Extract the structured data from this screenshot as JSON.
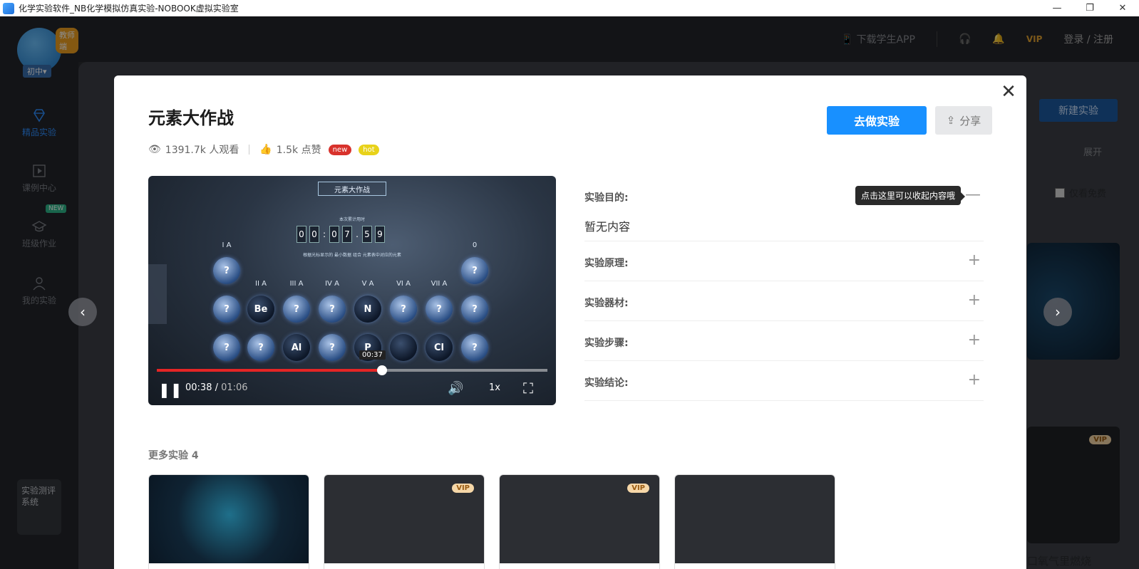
{
  "window": {
    "title": "化学实验软件_NB化学模拟仿真实验-NOBOOK虚拟实验室",
    "minimize": "—",
    "maximize": "❐",
    "close": "✕"
  },
  "sidebar": {
    "badge": "教师端",
    "level": "初中▾",
    "items": [
      {
        "label": "精品实验",
        "icon": "diamond-icon"
      },
      {
        "label": "课例中心",
        "icon": "play-square-icon"
      },
      {
        "label": "班级作业",
        "icon": "graduation-cap-icon"
      },
      {
        "label": "我的实验",
        "icon": "user-icon"
      }
    ],
    "new_tag": "NEW",
    "eval_label": "实验测评系统"
  },
  "topbar": {
    "download": "下载学生APP",
    "vip": "VIP",
    "login": "登录 / 注册"
  },
  "background": {
    "new_experiment": "新建实验",
    "expand": "展开",
    "free_only": "仅看免费",
    "caption": "口氧气里燃烧",
    "vip": "VIP"
  },
  "modal": {
    "title": "元素大作战",
    "views": "1391.7k 人观看",
    "likes": "1.5k 点赞",
    "badge_new": "new",
    "badge_hot": "hot",
    "primary_button": "去做实验",
    "share_button": "分享",
    "close": "✕",
    "video": {
      "inner_title": "元素大作战",
      "subtitle": "本次累计用时",
      "timer": [
        "0",
        "0",
        ":",
        "0",
        "7",
        ".",
        "5",
        "9"
      ],
      "hint": "根据光标显示的 最小数据 组合 元素表中对应的元素",
      "groups": [
        "I A",
        "II A",
        "III A",
        "IV A",
        "V A",
        "VI A",
        "VII A",
        "0"
      ],
      "row1": [
        "?",
        "?"
      ],
      "row2": [
        "?",
        "Be",
        "?",
        "?",
        "N",
        "?",
        "?",
        "?"
      ],
      "row3": [
        "?",
        "?",
        "Al",
        "?",
        "P",
        "",
        "Cl",
        "?"
      ],
      "hover_time": "00:37",
      "progress": 0.576,
      "current_time": "00:38 /",
      "duration": " 01:06",
      "speed": "1x"
    },
    "info": {
      "tooltip": "点击这里可以收起内容哦",
      "rows": [
        {
          "label": "实验目的:",
          "toggle": "—",
          "content": "暂无内容"
        },
        {
          "label": "实验原理:",
          "toggle": "+"
        },
        {
          "label": "实验器材:",
          "toggle": "+"
        },
        {
          "label": "实验步骤:",
          "toggle": "+"
        },
        {
          "label": "实验结论:",
          "toggle": "+"
        }
      ]
    },
    "more_title": "更多实验 4",
    "more_cards": [
      {
        "vip": ""
      },
      {
        "vip": "VIP"
      },
      {
        "vip": "VIP"
      },
      {
        "vip": ""
      }
    ]
  },
  "carousel": {
    "prev": "‹",
    "next": "›"
  }
}
